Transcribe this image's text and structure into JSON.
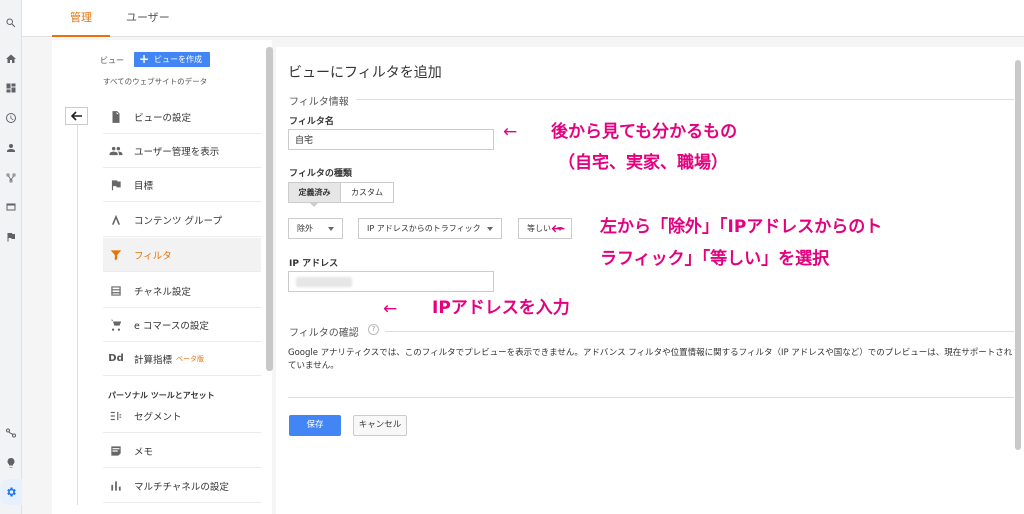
{
  "tabs": {
    "admin": "管理",
    "user": "ユーザー"
  },
  "nav": {
    "view_label": "ビュー",
    "create_view": "ビューを作成",
    "all_sites": "すべてのウェブサイトのデータ",
    "items": [
      {
        "label": "ビューの設定",
        "icon": "document-icon"
      },
      {
        "label": "ユーザー管理を表示",
        "icon": "users-icon"
      },
      {
        "label": "目標",
        "icon": "flag-icon"
      },
      {
        "label": "コンテンツ グループ",
        "icon": "walk-icon"
      },
      {
        "label": "フィルタ",
        "icon": "filter-icon"
      },
      {
        "label": "チャネル設定",
        "icon": "channel-icon"
      },
      {
        "label": "e コマースの設定",
        "icon": "cart-icon"
      },
      {
        "label": "計算指標",
        "icon": "dd-icon",
        "badge": "ベータ版",
        "icon_text": "Dd"
      },
      {
        "label": "セグメント",
        "icon": "segment-icon"
      },
      {
        "label": "メモ",
        "icon": "note-icon"
      },
      {
        "label": "マルチチャネルの設定",
        "icon": "bar-chart-icon"
      }
    ],
    "section_personal": "パーソナル ツールとアセット"
  },
  "form": {
    "title": "ビューにフィルタを追加",
    "info_section": "フィルタ情報",
    "name_label": "フィルタ名",
    "name_value": "自宅",
    "type_label": "フィルタの種類",
    "type_predefined": "定義済み",
    "type_custom": "カスタム",
    "dd_exclude": "除外",
    "dd_source": "IP アドレスからのトラフィック",
    "dd_equal": "等しい",
    "ip_label": "IP アドレス",
    "verify_section": "フィルタの確認",
    "help": "?",
    "description": "Google アナリティクスでは、このフィルタでプレビューを表示できません。アドバンス フィルタや位置情報に関するフィルタ（IP アドレスや国など）でのプレビューは、現在サポートされていません。",
    "save": "保存",
    "cancel": "キャンセル"
  },
  "annotations": {
    "arrow": "←",
    "name_line1": "後から見ても分かるもの",
    "name_line2": "（自宅、実家、職場）",
    "type_line1": "左から「除外」「IPアドレスからのト",
    "type_line2": "ラフィック」「等しい」を選択",
    "ip_line": "IPアドレスを入力"
  },
  "colors": {
    "accent_orange": "#e8710a",
    "primary_blue": "#4285f4",
    "annotation_pink": "#e5007f"
  }
}
